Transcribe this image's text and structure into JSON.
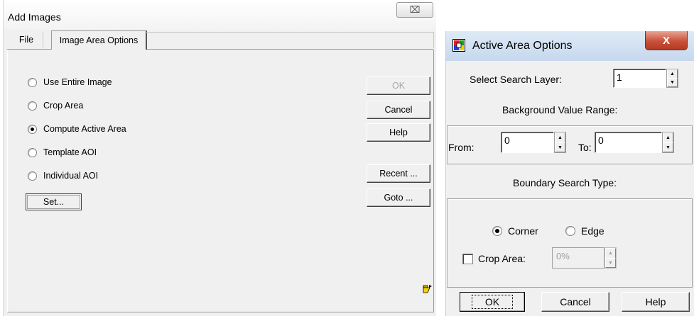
{
  "add_images": {
    "title": "Add Images",
    "close_glyph": "⌧",
    "tabs": [
      {
        "label": "File",
        "active": false
      },
      {
        "label": "Image Area Options",
        "active": true
      }
    ],
    "options": [
      {
        "label": "Use Entire Image",
        "checked": false
      },
      {
        "label": "Crop Area",
        "checked": false
      },
      {
        "label": "Compute Active Area",
        "checked": true
      },
      {
        "label": "Template AOI",
        "checked": false
      },
      {
        "label": "Individual AOI",
        "checked": false
      }
    ],
    "set_button": "Set...",
    "buttons": {
      "ok": "OK",
      "cancel": "Cancel",
      "help": "Help",
      "recent": "Recent ...",
      "goto": "Goto ..."
    },
    "status_icon": "folder-arrow-icon"
  },
  "active_area_options": {
    "title": "Active Area Options",
    "close_glyph": "X",
    "select_search_layer_label": "Select Search Layer:",
    "select_search_layer_value": "1",
    "background_range_label": "Background Value Range:",
    "from_label": "From:",
    "from_value": "0",
    "to_label": "To:",
    "to_value": "0",
    "boundary_label": "Boundary Search Type:",
    "boundary_options": [
      {
        "label": "Corner",
        "checked": true
      },
      {
        "label": "Edge",
        "checked": false
      }
    ],
    "crop_area_label": "Crop Area:",
    "crop_area_checked": false,
    "crop_area_value": "0%",
    "buttons": {
      "ok": "OK",
      "cancel": "Cancel",
      "help": "Help"
    }
  },
  "colors": {
    "dialog_bg": "#f0f0f0",
    "title_gradient_top": "#dfeaf7",
    "close_red": "#c9503a"
  }
}
